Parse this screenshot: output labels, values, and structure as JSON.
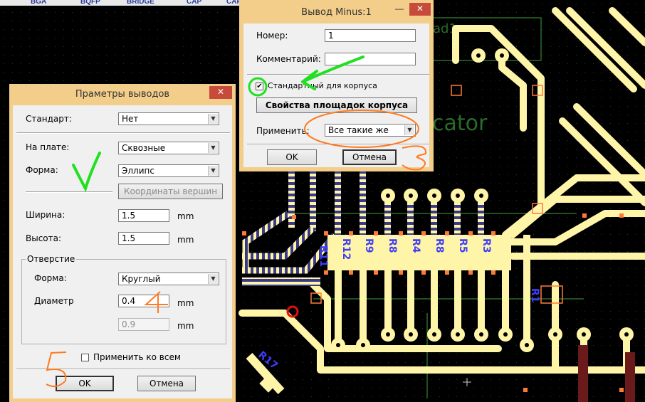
{
  "component_tabs": [
    "BGA",
    "BQFP",
    "BRIDGE",
    "CAP",
    "CAP"
  ],
  "board": {
    "ref_labels": [
      "R11",
      "R12",
      "R9",
      "R8",
      "R4",
      "R8",
      "R5",
      "R3",
      "R1",
      "R17"
    ],
    "bg_text_1": "cator",
    "bg_text_2": "ad1"
  },
  "pin_dialog": {
    "title": "Праметры выводов",
    "close_icon": "✕",
    "standard_label": "Стандарт:",
    "standard_value": "Нет",
    "onboard_label": "На плате:",
    "onboard_value": "Сквозные",
    "shape_label": "Форма:",
    "shape_value": "Эллипс",
    "vertex_button": "Координаты вершин",
    "width_label": "Ширина:",
    "width_value": "1.5",
    "height_label": "Высота:",
    "height_value": "1.5",
    "unit": "mm",
    "hole_group": "Отверстие",
    "hole_shape_label": "Форма:",
    "hole_shape_value": "Круглый",
    "diameter_label": "Диаметр",
    "diameter_value": "0.4",
    "diameter2_value": "0.9",
    "apply_all_label": "Применить ко всем",
    "ok": "OK",
    "cancel": "Отмена"
  },
  "minus_dialog": {
    "title": "Вывод Minus:1",
    "minimize_icon": "—",
    "close_icon": "✕",
    "number_label": "Номер:",
    "number_value": "1",
    "comment_label": "Комментарий:",
    "comment_value": "",
    "standard_check_label": "Стандартный для корпуса",
    "standard_checked": true,
    "pad_props_button": "Свойства площадок корпуса",
    "apply_label": "Применить:",
    "apply_value": "Все такие же",
    "ok": "OK",
    "cancel": "Отмена"
  },
  "annotations": [
    "3",
    "4",
    "5"
  ],
  "colors": {
    "trace": "#fff5a8",
    "pad": "#ff7a3a",
    "annotation_orange": "#ff7a20",
    "annotation_green": "#20e020",
    "silk": "#3d3dff"
  }
}
